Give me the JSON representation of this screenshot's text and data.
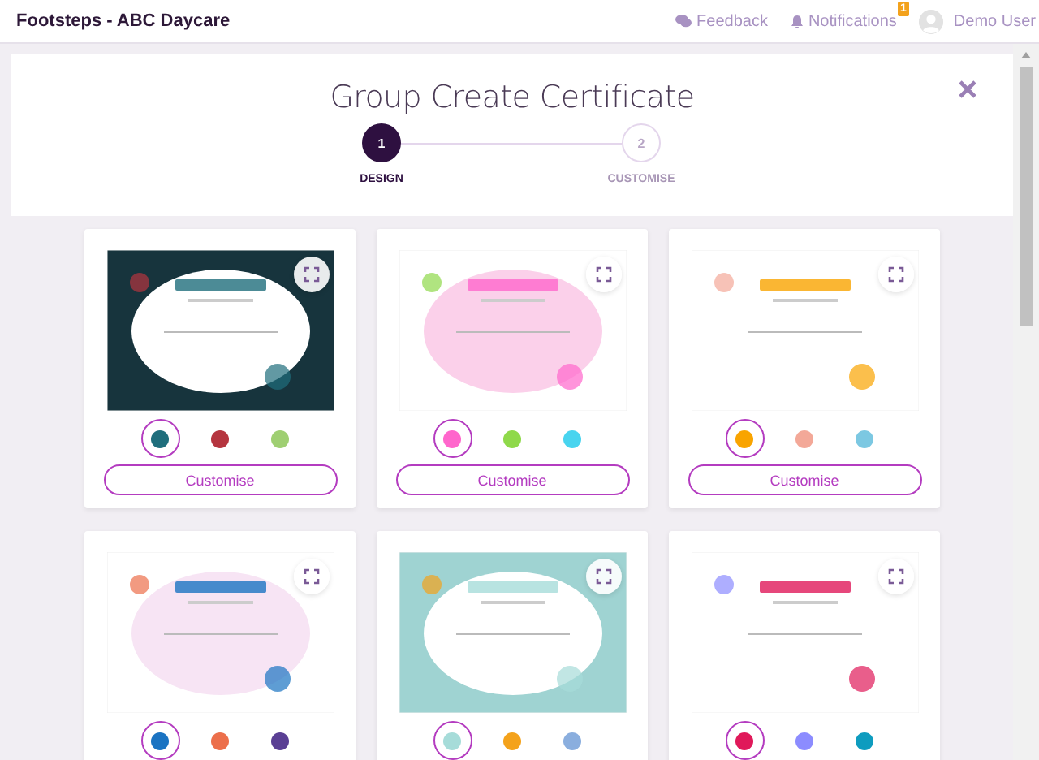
{
  "header": {
    "title": "Footsteps - ABC Daycare",
    "links": [
      {
        "kind": "feedback",
        "label": "Feedback"
      },
      {
        "kind": "notifications",
        "label": "Notifications",
        "badge": "1"
      }
    ],
    "user": "Demo User"
  },
  "dialog": {
    "title": "Group Create Certificate",
    "steps": [
      {
        "number": "1",
        "label": "DESIGN",
        "selected": true
      },
      {
        "number": "2",
        "label": "CUSTOMISE",
        "selected": false
      }
    ]
  },
  "templates": [
    {
      "swatches": [
        {
          "color": "#1f6e7c",
          "selected": true
        },
        {
          "color": "#b5353f",
          "selected": false
        },
        {
          "color": "#9fcf72",
          "selected": false
        }
      ],
      "button": "Customise"
    },
    {
      "swatches": [
        {
          "color": "#ff66cc",
          "selected": true
        },
        {
          "color": "#8fd94a",
          "selected": false
        },
        {
          "color": "#48d4ef",
          "selected": false
        }
      ],
      "button": "Customise"
    },
    {
      "swatches": [
        {
          "color": "#f9a400",
          "selected": true
        },
        {
          "color": "#f3a898",
          "selected": false
        },
        {
          "color": "#7cc8e2",
          "selected": false
        }
      ],
      "button": "Customise"
    },
    {
      "swatches": [
        {
          "color": "#1a73c2",
          "selected": true
        },
        {
          "color": "#ec6f4b",
          "selected": false
        },
        {
          "color": "#5a3f94",
          "selected": false
        }
      ]
    },
    {
      "swatches": [
        {
          "color": "#a6dcd9",
          "selected": true
        },
        {
          "color": "#f4a21b",
          "selected": false
        },
        {
          "color": "#8aaede",
          "selected": false
        }
      ]
    },
    {
      "swatches": [
        {
          "color": "#e0195a",
          "selected": true
        },
        {
          "color": "#8c8cff",
          "selected": false
        },
        {
          "color": "#0e9cbf",
          "selected": false
        }
      ]
    }
  ]
}
